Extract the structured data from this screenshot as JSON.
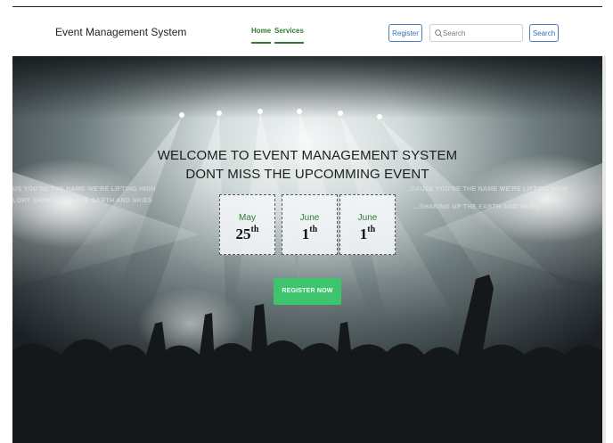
{
  "navbar": {
    "brand": "Event Management System",
    "links": [
      {
        "label": "Home"
      },
      {
        "label": "Services"
      }
    ],
    "register_label": "Register",
    "search_placeholder": "Search",
    "search_button_label": "Search"
  },
  "hero": {
    "title_line1": "WELCOME TO EVENT MANAGEMENT SYSTEM",
    "title_line2": "DONT MISS THE UPCOMMING EVENT",
    "events": [
      {
        "month": "May",
        "day": "25",
        "suffix": "th"
      },
      {
        "month": "June",
        "day": "1",
        "suffix": "th"
      },
      {
        "month": "June",
        "day": "1",
        "suffix": "th"
      }
    ],
    "cta_label": "REGISTER NOW"
  },
  "background_text": {
    "left_line1": "US YOU'RE THE NAME WE'RE LIFTING HIGH",
    "left_line2": "LORY SHAKING UP THE EARTH AND SKIES",
    "right_line1": "...CAUSE YOU'RE THE NAME WE'RE LIFTING HIGH",
    "right_line2": "...SHAKING UP THE EARTH AND SKIES"
  },
  "colors": {
    "accent_green": "#2e7d32",
    "cta_green": "#3ec46d",
    "outline_blue": "#4a7fc1"
  }
}
